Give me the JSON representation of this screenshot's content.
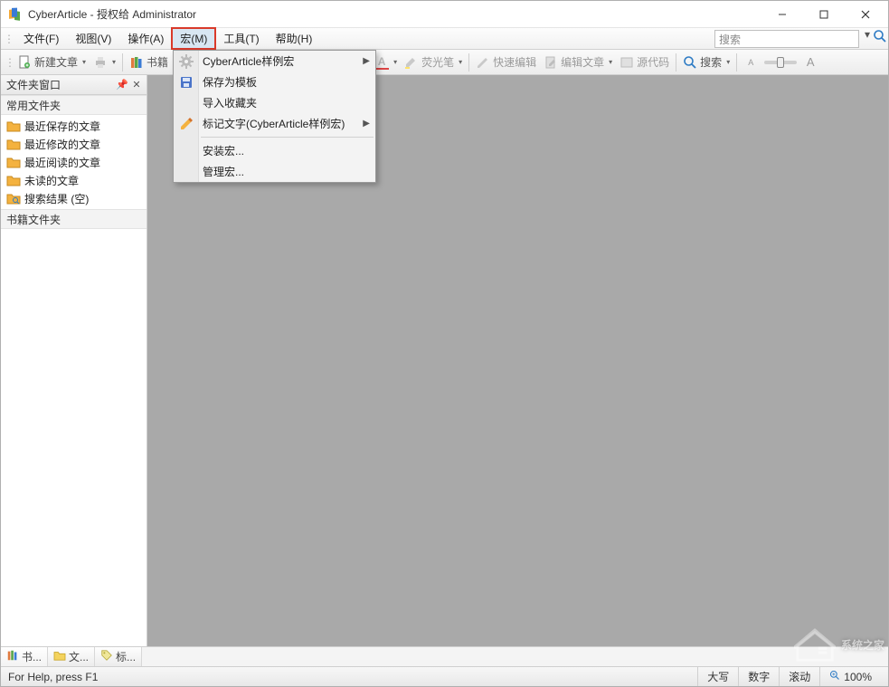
{
  "window": {
    "title": "CyberArticle - 授权给 Administrator"
  },
  "menubar": {
    "items": [
      {
        "label": "文件(F)",
        "key": "file"
      },
      {
        "label": "视图(V)",
        "key": "view"
      },
      {
        "label": "操作(A)",
        "key": "action"
      },
      {
        "label": "宏(M)",
        "key": "macro",
        "open": true,
        "highlight": true
      },
      {
        "label": "工具(T)",
        "key": "tools"
      },
      {
        "label": "帮助(H)",
        "key": "help"
      }
    ],
    "search_placeholder": "搜索"
  },
  "toolbar": {
    "new_doc": "新建文章",
    "books": "书籍",
    "highlighter": "荧光笔",
    "quick_edit": "快速编辑",
    "edit_article": "编辑文章",
    "source_code": "源代码",
    "search": "搜索"
  },
  "macro_menu": {
    "items": [
      {
        "label": "CyberArticle样例宏",
        "icon": "gear",
        "submenu": true
      },
      {
        "label": "保存为模板",
        "icon": "save-template"
      },
      {
        "label": "导入收藏夹",
        "icon": null
      },
      {
        "label": "标记文字(CyberArticle样例宏)",
        "icon": "pencil",
        "submenu": true
      },
      {
        "sep": true
      },
      {
        "label": "安装宏..."
      },
      {
        "label": "管理宏..."
      }
    ]
  },
  "sidebar": {
    "panel_title": "文件夹窗口",
    "section_common": "常用文件夹",
    "items": [
      {
        "label": "最近保存的文章",
        "icon": "folder-orange"
      },
      {
        "label": "最近修改的文章",
        "icon": "folder-orange"
      },
      {
        "label": "最近阅读的文章",
        "icon": "folder-orange"
      },
      {
        "label": "未读的文章",
        "icon": "folder-orange"
      },
      {
        "label": "搜索结果 (空)",
        "icon": "folder-search"
      }
    ],
    "section_books": "书籍文件夹",
    "tabs": [
      {
        "label": "书...",
        "icon": "book"
      },
      {
        "label": "文...",
        "icon": "folder"
      },
      {
        "label": "标...",
        "icon": "tag"
      }
    ]
  },
  "statusbar": {
    "help": "For Help, press F1",
    "caps": "大写",
    "num": "数字",
    "scroll": "滚动",
    "zoom": "100%"
  },
  "watermark": "系统之家"
}
